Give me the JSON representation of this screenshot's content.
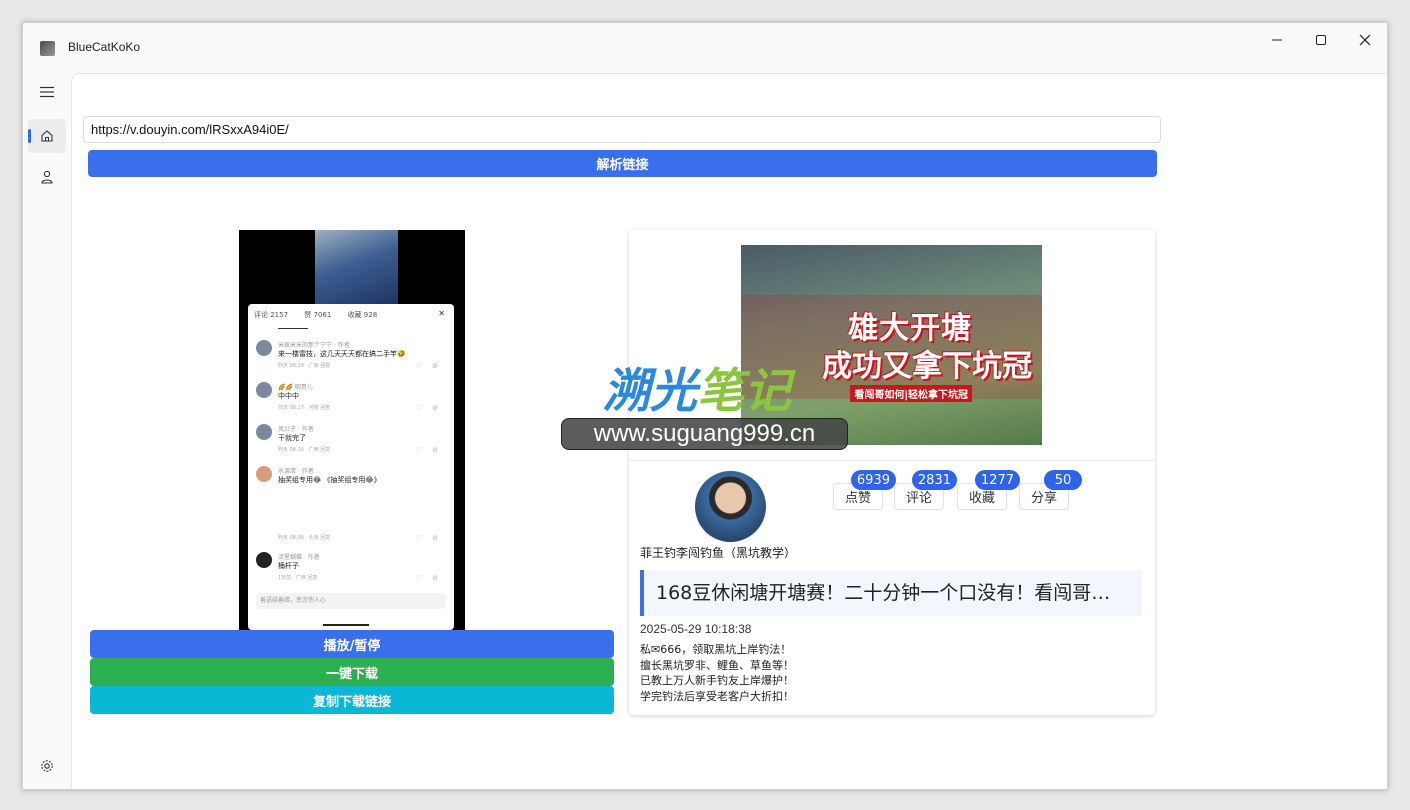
{
  "window": {
    "title": "BlueCatKoKo"
  },
  "input": {
    "url": "https://v.douyin.com/lRSxxA94i0E/"
  },
  "buttons": {
    "parse": "解析链接",
    "play_pause": "播放/暂停",
    "download": "一键下载",
    "copy_link": "复制下载链接"
  },
  "video_preview": {
    "tabs": [
      "评论 2157",
      "赞 7061",
      "收藏 928"
    ],
    "input_placeholder": "善语结善缘，恶言伤人心",
    "comments": [
      {
        "user": "米家米米的那个宁宁 · 作者",
        "text": "来一楼雷技，这几天天天都在搞二手竿🤣",
        "meta": "昨天 08:28 · 广西    回复"
      },
      {
        "user": "🌈🌈 明哥儿",
        "text": "中中中",
        "meta": "前天 08:27 · 河南    回复"
      },
      {
        "user": "风公子 · 作者",
        "text": "干就完了",
        "meta": "昨天 08:16 · 广西    回复"
      },
      {
        "user": "水源清 · 作者",
        "text": "抽奖组专用😂 《抽奖组专用😂》",
        "meta": "昨天 08:36 · 北京    回复"
      },
      {
        "user": "流星蝴蝶 · 作者",
        "text": "桶杆子",
        "meta": "1天前 · 广西    回复"
      }
    ]
  },
  "video_info": {
    "cover_text": [
      "雄大开塘",
      "成功又拿下坑冠",
      "看闯哥如何|轻松拿下坑冠"
    ],
    "author": "菲王钓李闯钓鱼（黑坑教学）",
    "stats": [
      {
        "label": "点赞",
        "count": "6939"
      },
      {
        "label": "评论",
        "count": "2831"
      },
      {
        "label": "收藏",
        "count": "1277"
      },
      {
        "label": "分享",
        "count": "50"
      }
    ],
    "title": "168豆休闲塘开塘赛！二十分钟一个口没有！看闯哥…",
    "publish_time": "2025-05-29 10:18:38",
    "description": [
      "私✉666，领取黑坑上岸钓法！",
      "擅长黑坑罗非、鲤鱼、草鱼等！",
      "已教上万人新手钓友上岸爆护！",
      "学完钓法后享受老客户大折扣！"
    ]
  },
  "watermark": {
    "brand_a": "溯光",
    "brand_b": "笔记",
    "url": "www.suguang999.cn"
  },
  "colors": {
    "primary": "#3a6fec",
    "success": "#2ab04f",
    "info": "#0ab7d4",
    "badge": "#2f64ea"
  }
}
